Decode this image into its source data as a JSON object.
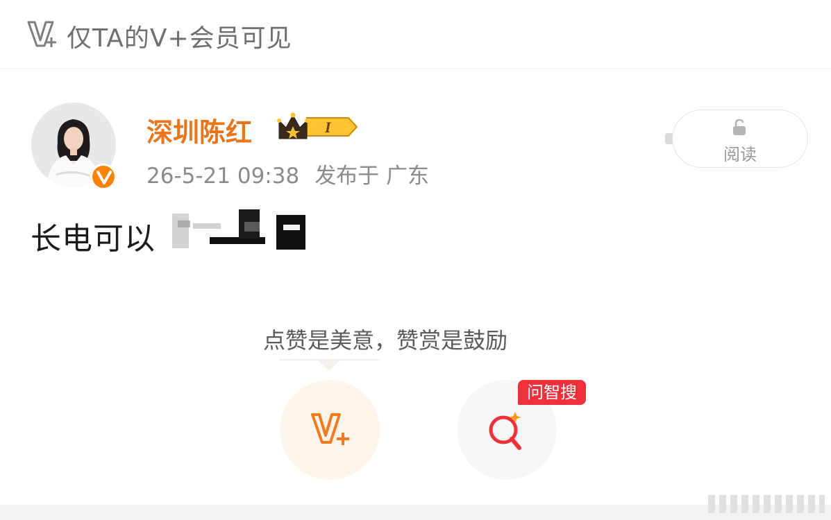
{
  "header": {
    "visibility_text": "仅TA的V+会员可见",
    "icon": "vplus-icon"
  },
  "author": {
    "name": "深圳陈红",
    "badge_level": "I",
    "verified": true,
    "timestamp": "26-5-21 09:38",
    "location": "发布于 广东"
  },
  "read_button": {
    "label": "阅读",
    "icon": "lock-icon"
  },
  "post": {
    "text": "长电可以"
  },
  "reward": {
    "hint": "点赞是美意，赞赏是鼓励",
    "vplus_icon": "vplus-icon",
    "search_tag": "问智搜",
    "search_icon": "search-icon"
  },
  "colors": {
    "accent_orange": "#ff8200",
    "username": "#e8751a",
    "search_red": "#f0313a"
  }
}
